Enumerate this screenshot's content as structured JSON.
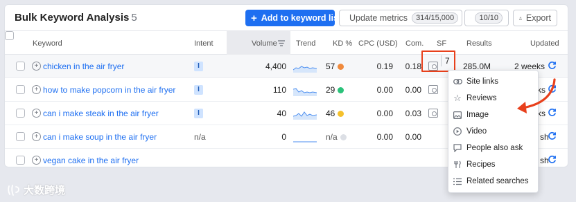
{
  "header": {
    "title": "Bulk Keyword Analysis",
    "count": "5",
    "add_button": "Add to keyword list",
    "update_button": "Update metrics",
    "update_pill": "314/15,000",
    "gear_pill": "10/10",
    "export_button": "Export"
  },
  "columns": {
    "keyword": "Keyword",
    "intent": "Intent",
    "volume": "Volume",
    "trend": "Trend",
    "kd": "KD %",
    "cpc": "CPC (USD)",
    "com": "Com.",
    "sf": "SF",
    "results": "Results",
    "updated": "Updated"
  },
  "rows": [
    {
      "keyword": "chicken in the air fryer",
      "intent": "I",
      "volume": "4,400",
      "kd": "57",
      "kd_color": "#f08a3c",
      "cpc": "0.19",
      "com": "0.18",
      "results": "285.0M",
      "updated": "2 weeks"
    },
    {
      "keyword": "how to make popcorn in the air fryer",
      "intent": "I",
      "volume": "110",
      "kd": "29",
      "kd_color": "#2bc27a",
      "cpc": "0.00",
      "com": "0.00",
      "results": "",
      "updated": "ks"
    },
    {
      "keyword": "can i make steak in the air fryer",
      "intent": "I",
      "volume": "40",
      "kd": "46",
      "kd_color": "#f5c12c",
      "cpc": "0.00",
      "com": "0.03",
      "results": "",
      "updated": "ks"
    },
    {
      "keyword": "can i make soup in the air fryer",
      "intent": "n/a",
      "volume": "0",
      "kd": "n/a",
      "kd_color": "#dcdfe5",
      "cpc": "0.00",
      "com": "0.00",
      "results": "",
      "updated": "sh"
    },
    {
      "keyword": "vegan cake in the air fryer",
      "intent": "",
      "volume": "",
      "kd": "",
      "kd_color": "",
      "cpc": "",
      "com": "",
      "results": "",
      "updated": "sh"
    }
  ],
  "sf_count": "7",
  "dropdown": [
    {
      "label": "Site links",
      "icon": "link-icon"
    },
    {
      "label": "Reviews",
      "icon": "star-icon"
    },
    {
      "label": "Image",
      "icon": "image-icon"
    },
    {
      "label": "Video",
      "icon": "play-icon"
    },
    {
      "label": "People also ask",
      "icon": "question-icon"
    },
    {
      "label": "Recipes",
      "icon": "fork-knife-icon"
    },
    {
      "label": "Related searches",
      "icon": "list-icon"
    }
  ],
  "watermark": "大数跨境",
  "colors": {
    "accent": "#1e6ff1",
    "highlight": "#e8401c"
  }
}
